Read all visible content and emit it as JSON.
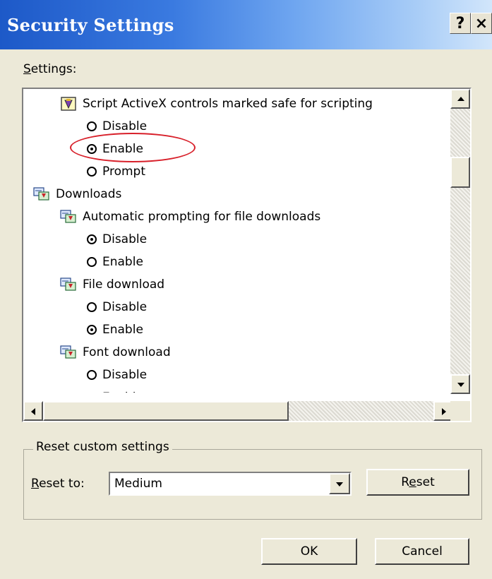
{
  "window": {
    "title": "Security Settings",
    "help_label": "?",
    "close_label": "×"
  },
  "settings_list": {
    "label_first": "S",
    "label_rest": "ettings:",
    "rows": [
      {
        "kind": "setting",
        "text": "Script ActiveX controls marked safe for scripting",
        "icon": "activex-setting-icon"
      },
      {
        "kind": "option",
        "text": "Disable",
        "checked": false
      },
      {
        "kind": "option",
        "text": "Enable",
        "checked": true
      },
      {
        "kind": "option",
        "text": "Prompt",
        "checked": false
      },
      {
        "kind": "category",
        "text": "Downloads",
        "icon": "downloads-category-icon"
      },
      {
        "kind": "setting",
        "text": "Automatic prompting for file downloads",
        "icon": "download-setting-icon"
      },
      {
        "kind": "option",
        "text": "Disable",
        "checked": true
      },
      {
        "kind": "option",
        "text": "Enable",
        "checked": false
      },
      {
        "kind": "setting",
        "text": "File download",
        "icon": "download-setting-icon"
      },
      {
        "kind": "option",
        "text": "Disable",
        "checked": false
      },
      {
        "kind": "option",
        "text": "Enable",
        "checked": true
      },
      {
        "kind": "setting",
        "text": "Font download",
        "icon": "download-setting-icon"
      },
      {
        "kind": "option",
        "text": "Disable",
        "checked": false
      },
      {
        "kind": "option",
        "text": "Enable",
        "checked": true
      }
    ],
    "highlight_color": "#d8202a"
  },
  "reset_group": {
    "legend": "Reset custom settings",
    "reset_label_first": "R",
    "reset_label_rest": "eset to:",
    "selected_level": "Medium",
    "reset_button_label_pre": "R",
    "reset_button_label_ul": "e",
    "reset_button_label_post": "set"
  },
  "buttons": {
    "ok_label": "OK",
    "cancel_label": "Cancel"
  },
  "colors": {
    "title_gradient_start": "#1d59c8",
    "dialog_background": "#ece9d8"
  }
}
